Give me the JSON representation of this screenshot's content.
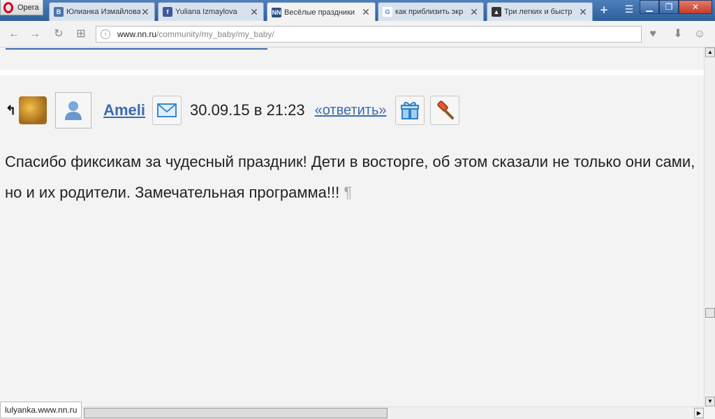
{
  "browser": {
    "menu_label": "Opera",
    "tabs": [
      {
        "title": "Юлианка Измайлова",
        "favicon": "В",
        "favicon_color": "#4a76a8"
      },
      {
        "title": "Yuliana Izmaylova",
        "favicon": "f",
        "favicon_color": "#3b5998"
      },
      {
        "title": "Весёлые праздники",
        "favicon": "NN",
        "favicon_color": "#2b4f86"
      },
      {
        "title": "как приблизить экр",
        "favicon": "G",
        "favicon_color": "#4285f4"
      },
      {
        "title": "Три легких и быстр",
        "favicon": "▲",
        "favicon_color": "#333333"
      }
    ],
    "url_host": "www.nn.ru",
    "url_path": "/community/my_baby/my_baby/"
  },
  "comment": {
    "author": "Ameli",
    "datetime": "30.09.15 в 21:23",
    "reply_label": "«ответить»",
    "text": "Спасибо фиксикам за чудесный праздник! Дети в восторге, об этом сказали не только они сами, но и их родители. Замечательная программа!!!",
    "para_mark": "¶"
  },
  "status_bar": "lulyanka.www.nn.ru"
}
